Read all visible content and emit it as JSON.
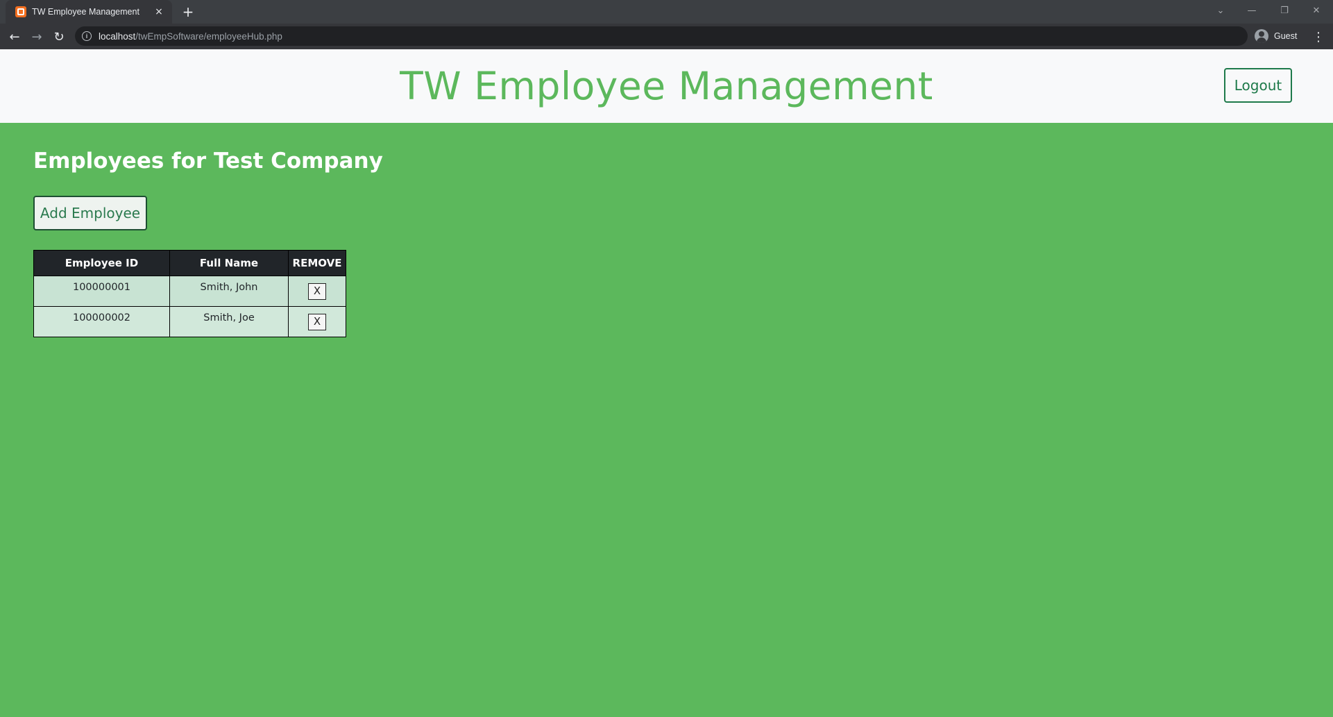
{
  "browser": {
    "tab_title": "TW Employee Management",
    "tab_close": "×",
    "new_tab": "+",
    "url_host": "localhost",
    "url_path": "/twEmpSoftware/employeeHub.php",
    "profile_label": "Guest",
    "back": "←",
    "forward": "→",
    "reload": "↻",
    "menu": "⋮",
    "win_collapse": "⌄",
    "win_min": "—",
    "win_restore": "❐",
    "win_close": "✕"
  },
  "header": {
    "title": "TW Employee Management",
    "logout_label": "Logout"
  },
  "main": {
    "heading": "Employees for Test Company",
    "add_label": "Add Employee"
  },
  "table": {
    "headers": [
      "Employee ID",
      "Full Name",
      "REMOVE"
    ],
    "rows": [
      {
        "id": "100000001",
        "name": "Smith, John",
        "remove": "X"
      },
      {
        "id": "100000002",
        "name": "Smith, Joe",
        "remove": "X"
      }
    ]
  },
  "colors": {
    "page_background": "#5cb85c",
    "header_background": "#f8f9fa",
    "accent_green": "#5cb85c",
    "button_border": "#1e7a4a",
    "table_header": "#212529",
    "row_a": "#c8e3d3",
    "row_b": "#d1e8da"
  }
}
